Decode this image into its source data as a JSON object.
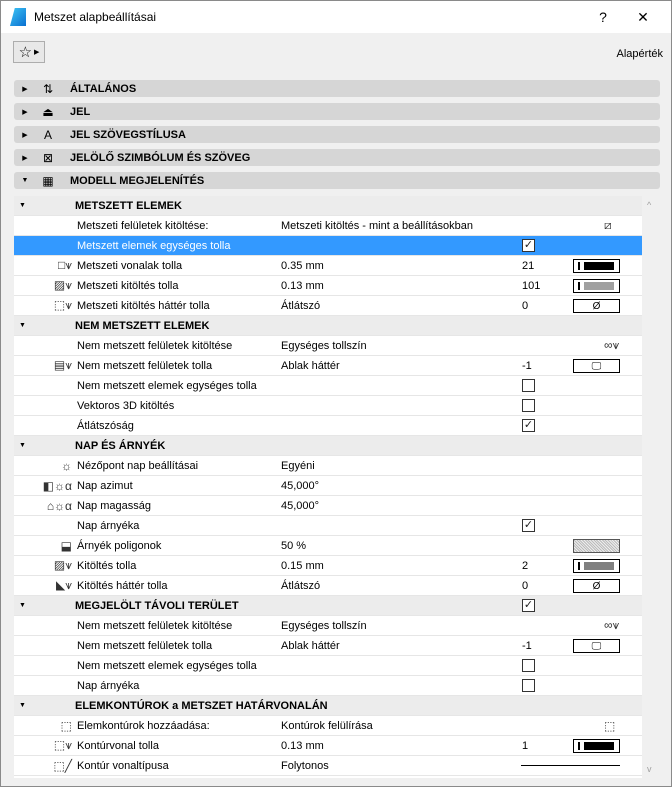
{
  "window": {
    "title": "Metszet alapbeállításai",
    "help": "?",
    "close": "✕"
  },
  "toolbar": {
    "favorites_icon": "☆",
    "favorites_arrow": "▶",
    "defaults_label": "Alapérték"
  },
  "panels": [
    {
      "label": "ÁLTALÁNOS",
      "icon": "⇅",
      "expanded": false
    },
    {
      "label": "JEL",
      "icon": "⏏",
      "expanded": false
    },
    {
      "label": "JEL SZÖVEGSTÍLUSA",
      "icon": "A",
      "expanded": false
    },
    {
      "label": "JELÖLŐ SZIMBÓLUM ÉS SZÖVEG",
      "icon": "⊠",
      "expanded": false
    },
    {
      "label": "MODELL MEGJELENÍTÉS",
      "icon": "▦",
      "expanded": true
    }
  ],
  "rows": [
    {
      "type": "hdr",
      "label": "METSZETT ELEMEK"
    },
    {
      "label": "Metszeti felületek kitöltése:",
      "value": "Metszeti kitöltés - mint a beállításokban",
      "right_icon": "⧄"
    },
    {
      "label": "Metszett elemek egységes tolla",
      "check": true,
      "selected": true
    },
    {
      "icon": "□⩛",
      "label": "Metszeti vonalak tolla",
      "value": "0.35 mm",
      "num": "21",
      "swatch": "pen",
      "pen_color": "#000000"
    },
    {
      "icon": "▨⩛",
      "label": "Metszeti kitöltés tolla",
      "value": "0.13 mm",
      "num": "101",
      "swatch": "pen",
      "pen_color": "#a0a0a0"
    },
    {
      "icon": "⬚⩛",
      "label": "Metszeti kitöltés háttér tolla",
      "value": "Átlátszó",
      "num": "0",
      "swatch": "empty",
      "swatch_text": "Ø"
    },
    {
      "type": "hdr",
      "label": "NEM METSZETT ELEMEK"
    },
    {
      "label": "Nem metszett felületek kitöltése",
      "value": "Egységes tollszín",
      "right_icon": "∞⩛"
    },
    {
      "icon": "▤⩛",
      "label": "Nem metszett felületek tolla",
      "value": "Ablak háttér",
      "num": "-1",
      "swatch": "empty",
      "swatch_text": "🖵"
    },
    {
      "label": "Nem metszett elemek egységes tolla",
      "check": false
    },
    {
      "label": "Vektoros 3D kitöltés",
      "check": false
    },
    {
      "label": "Átlátszóság",
      "check": true
    },
    {
      "type": "hdr",
      "label": "NAP ÉS ÁRNYÉK"
    },
    {
      "icon": "☼",
      "label": "Nézőpont nap beállításai",
      "value": "Egyéni"
    },
    {
      "icon": "◧☼α",
      "label": "Nap azimut",
      "value": "45,000°"
    },
    {
      "icon": "⌂☼α",
      "label": "Nap magasság",
      "value": "45,000°"
    },
    {
      "label": "Nap árnyéka",
      "check": true
    },
    {
      "icon": "⬓",
      "label": "Árnyék poligonok",
      "value": "50 %",
      "swatch": "hatch"
    },
    {
      "icon": "▨⩛",
      "label": "Kitöltés tolla",
      "value": "0.15 mm",
      "num": "2",
      "swatch": "pen",
      "pen_color": "#808080"
    },
    {
      "icon": "◣⩛",
      "label": "Kitöltés háttér tolla",
      "value": "Átlátszó",
      "num": "0",
      "swatch": "empty",
      "swatch_text": "Ø"
    },
    {
      "type": "hdr",
      "label": "MEGJELÖLT TÁVOLI TERÜLET",
      "check": true
    },
    {
      "label": "Nem metszett felületek kitöltése",
      "value": "Egységes tollszín",
      "right_icon": "∞⩛"
    },
    {
      "label": "Nem metszett felületek tolla",
      "value": "Ablak háttér",
      "num": "-1",
      "swatch": "empty",
      "swatch_text": "🖵"
    },
    {
      "label": "Nem metszett elemek egységes tolla",
      "check": false
    },
    {
      "label": "Nap árnyéka",
      "check": false
    },
    {
      "type": "hdr",
      "label": "ELEMKONTÚROK a METSZET HATÁRVONALÁN"
    },
    {
      "icon": "⬚",
      "label": "Elemkontúrok hozzáadása:",
      "value": "Kontúrok felülírása",
      "right_icon": "⬚"
    },
    {
      "icon": "⬚⩛",
      "label": "Kontúrvonal tolla",
      "value": "0.13 mm",
      "num": "1",
      "swatch": "pen",
      "pen_color": "#000000"
    },
    {
      "icon": "⬚╱",
      "label": "Kontúr vonaltípusa",
      "value": "Folytonos",
      "swatch": "line"
    }
  ],
  "scrollbar": {
    "up": "^",
    "down": "v"
  }
}
